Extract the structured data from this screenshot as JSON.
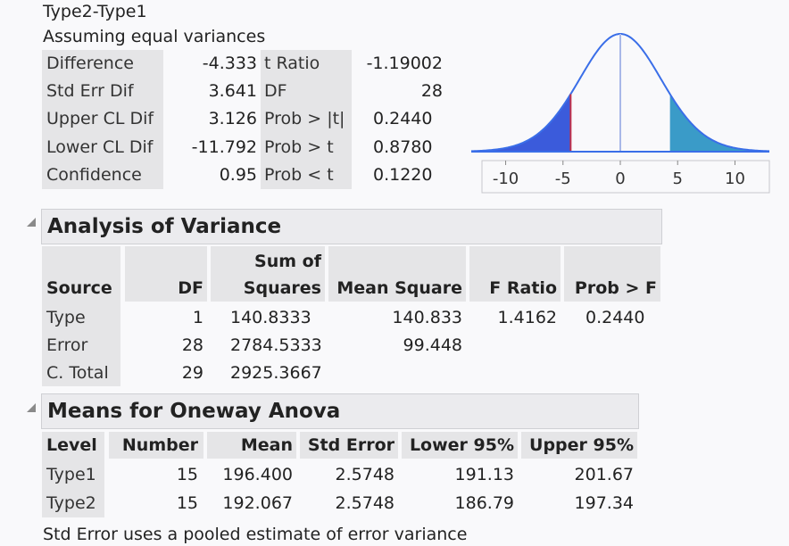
{
  "ttest": {
    "title": "Type2-Type1",
    "subtitle": "Assuming equal variances",
    "left_rows": [
      {
        "label": "Difference",
        "value": "-4.333"
      },
      {
        "label": "Std Err Dif",
        "value": "3.641"
      },
      {
        "label": "Upper CL Dif",
        "value": "3.126"
      },
      {
        "label": "Lower CL Dif",
        "value": "-11.792"
      },
      {
        "label": "Confidence",
        "value": "0.95"
      }
    ],
    "right_rows": [
      {
        "label": "t Ratio",
        "value": "-1.19002"
      },
      {
        "label": "DF",
        "value": "28"
      },
      {
        "label": "Prob > |t|",
        "value": "0.2440"
      },
      {
        "label": "Prob > t",
        "value": "0.8780"
      },
      {
        "label": "Prob < t",
        "value": "0.1220"
      }
    ],
    "plot": {
      "x_ticks": [
        "-10",
        "-5",
        "0",
        "5",
        "10"
      ],
      "left_fill": "#3b5bdb",
      "right_fill": "#3a9bc8",
      "curve_color": "#3a6ee8",
      "t_line_color": "#c0304a",
      "zero_line_color": "#a8b8e8"
    }
  },
  "anova": {
    "heading": "Analysis of Variance",
    "headers": {
      "source": "Source",
      "df": "DF",
      "ss_top": "Sum of",
      "ss": "Squares",
      "ms": "Mean Square",
      "f": "F Ratio",
      "p": "Prob > F"
    },
    "rows": [
      {
        "source": "Type",
        "df": "1",
        "ss": "140.8333",
        "ms": "140.833",
        "f": "1.4162",
        "p": "0.2440"
      },
      {
        "source": "Error",
        "df": "28",
        "ss": "2784.5333",
        "ms": "99.448",
        "f": "",
        "p": ""
      },
      {
        "source": "C. Total",
        "df": "29",
        "ss": "2925.3667",
        "ms": "",
        "f": "",
        "p": ""
      }
    ]
  },
  "means": {
    "heading": "Means for Oneway Anova",
    "headers": {
      "level": "Level",
      "number": "Number",
      "mean": "Mean",
      "se": "Std Error",
      "lower": "Lower 95%",
      "upper": "Upper 95%"
    },
    "rows": [
      {
        "level": "Type1",
        "number": "15",
        "mean": "196.400",
        "se": "2.5748",
        "lower": "191.13",
        "upper": "201.67"
      },
      {
        "level": "Type2",
        "number": "15",
        "mean": "192.067",
        "se": "2.5748",
        "lower": "186.79",
        "upper": "197.34"
      }
    ],
    "footnote": "Std Error uses a pooled estimate of error variance"
  }
}
